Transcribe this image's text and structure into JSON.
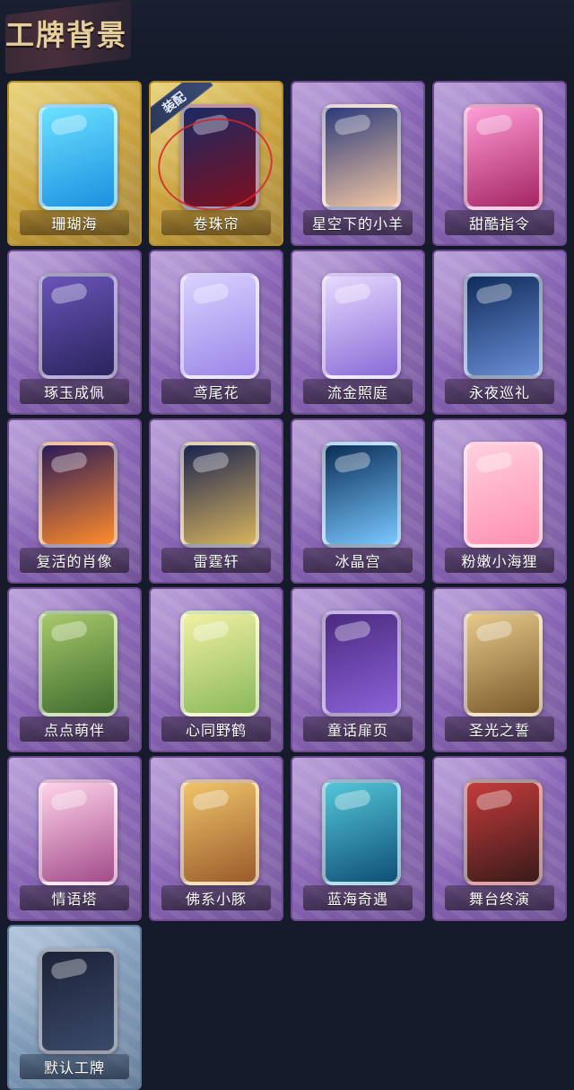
{
  "page": {
    "title": "工牌背景"
  },
  "badge": {
    "equipped_label": "装配"
  },
  "cards": [
    {
      "name": "珊瑚海",
      "theme": "gold",
      "art_colors": [
        "#69e2ff",
        "#1d8fe0"
      ]
    },
    {
      "name": "卷珠帘",
      "theme": "gold",
      "art_colors": [
        "#1a2a64",
        "#7e0f1f"
      ],
      "equipped": true
    },
    {
      "name": "星空下的小羊",
      "theme": "purple",
      "art_colors": [
        "#2b3a7a",
        "#f2c6a3"
      ]
    },
    {
      "name": "甜酷指令",
      "theme": "purple",
      "art_colors": [
        "#ff9bd6",
        "#a42463"
      ]
    },
    {
      "name": "琢玉成佩",
      "theme": "purple",
      "art_colors": [
        "#6a54b8",
        "#2a245e"
      ]
    },
    {
      "name": "鸢尾花",
      "theme": "purple",
      "art_colors": [
        "#d8d1ff",
        "#9b86e8"
      ]
    },
    {
      "name": "流金照庭",
      "theme": "purple",
      "art_colors": [
        "#e6d8ff",
        "#8a6bd6"
      ]
    },
    {
      "name": "永夜巡礼",
      "theme": "purple",
      "art_colors": [
        "#0f2b5a",
        "#6a8ed6"
      ]
    },
    {
      "name": "复活的肖像",
      "theme": "purple",
      "art_colors": [
        "#2b1b58",
        "#ff8b2b"
      ]
    },
    {
      "name": "雷霆轩",
      "theme": "purple",
      "art_colors": [
        "#1a2350",
        "#d7b35e"
      ]
    },
    {
      "name": "冰晶宫",
      "theme": "purple",
      "art_colors": [
        "#0a2d56",
        "#79c7ff"
      ]
    },
    {
      "name": "粉嫩小海狸",
      "theme": "purple",
      "art_colors": [
        "#ffd0df",
        "#ff8fb1"
      ]
    },
    {
      "name": "点点萌伴",
      "theme": "purple",
      "art_colors": [
        "#a7c96a",
        "#3e6b2e"
      ]
    },
    {
      "name": "心同野鹤",
      "theme": "purple",
      "art_colors": [
        "#f1f0a3",
        "#8ab95a"
      ]
    },
    {
      "name": "童话扉页",
      "theme": "purple",
      "art_colors": [
        "#4b2a7f",
        "#8c62d8"
      ]
    },
    {
      "name": "圣光之誓",
      "theme": "purple",
      "art_colors": [
        "#e6c98a",
        "#7a5a2b"
      ]
    },
    {
      "name": "情语塔",
      "theme": "purple",
      "art_colors": [
        "#ffd3ea",
        "#a24b8a"
      ]
    },
    {
      "name": "佛系小豚",
      "theme": "purple",
      "art_colors": [
        "#f0c46a",
        "#9a5b2b"
      ]
    },
    {
      "name": "蓝海奇遇",
      "theme": "purple",
      "art_colors": [
        "#53c6d8",
        "#0f4f77"
      ]
    },
    {
      "name": "舞台终演",
      "theme": "purple",
      "art_colors": [
        "#c53b3b",
        "#3a1a1a"
      ]
    },
    {
      "name": "默认工牌",
      "theme": "blue",
      "art_colors": [
        "#1c2238",
        "#3a4a6a"
      ]
    }
  ]
}
